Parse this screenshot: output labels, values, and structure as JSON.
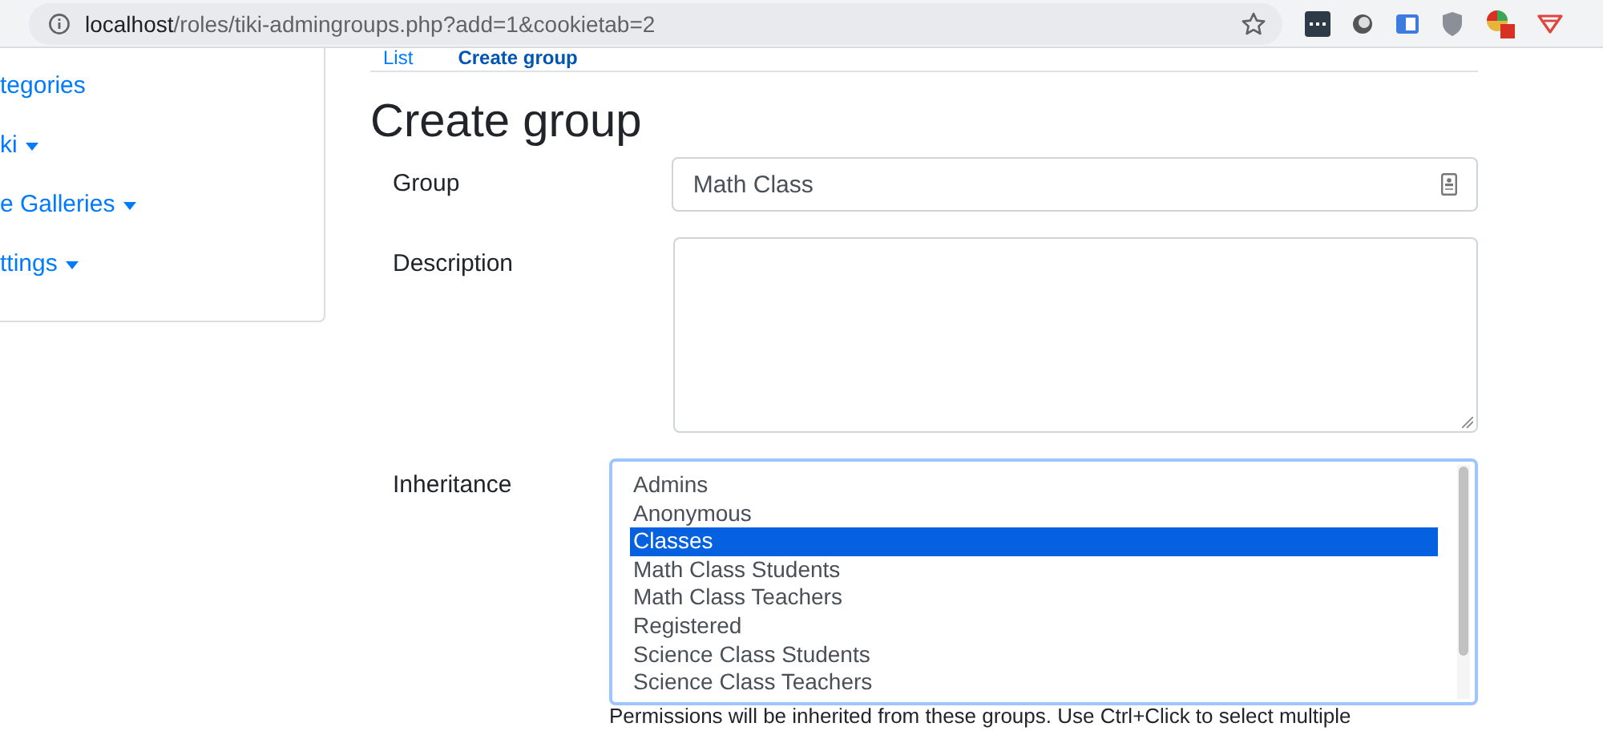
{
  "browser": {
    "url_host": "localhost",
    "url_path": "/roles/tiki-admingroups.php?add=1&cookietab=2"
  },
  "sidebar": {
    "items": [
      {
        "label": "tegories",
        "has_caret": false
      },
      {
        "label": "ki",
        "has_caret": true
      },
      {
        "label": "e Galleries",
        "has_caret": true
      },
      {
        "label": "ttings",
        "has_caret": true
      }
    ]
  },
  "tabs": [
    {
      "label": "List",
      "selected": false
    },
    {
      "label": "Create group",
      "selected": true
    }
  ],
  "heading": "Create group",
  "form": {
    "group": {
      "label": "Group",
      "value": "Math Class"
    },
    "description": {
      "label": "Description"
    },
    "inheritance": {
      "label": "Inheritance",
      "options": [
        {
          "label": "Admins",
          "selected": false
        },
        {
          "label": "Anonymous",
          "selected": false
        },
        {
          "label": "Classes",
          "selected": true
        },
        {
          "label": "Math Class Students",
          "selected": false
        },
        {
          "label": "Math Class Teachers",
          "selected": false
        },
        {
          "label": "Registered",
          "selected": false
        },
        {
          "label": "Science Class Students",
          "selected": false
        },
        {
          "label": "Science Class Teachers",
          "selected": false
        }
      ],
      "help": "Permissions will be inherited from these groups. Use Ctrl+Click to select multiple"
    }
  }
}
